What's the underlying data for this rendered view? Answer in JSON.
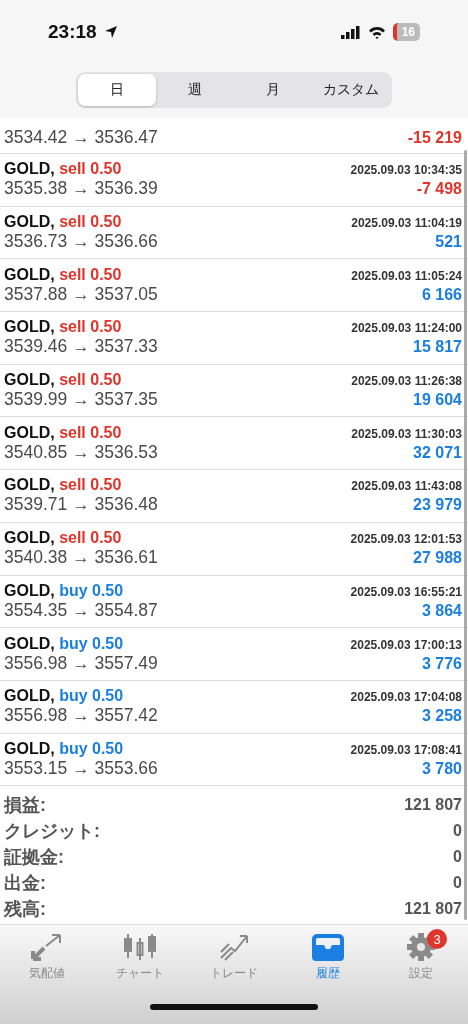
{
  "status_bar": {
    "time": "23:18",
    "battery": "16"
  },
  "period_tabs": [
    {
      "label": "日",
      "selected": true
    },
    {
      "label": "週",
      "selected": false
    },
    {
      "label": "月",
      "selected": false
    },
    {
      "label": "カスタム",
      "selected": false
    }
  ],
  "deals": [
    {
      "prices": "3534.42 → 3536.47",
      "profit": "-15 219",
      "loss": true
    },
    {
      "symbol": "GOLD,",
      "side": "sell 0.50",
      "kind": "sell",
      "time": "2025.09.03 10:34:35",
      "prices": "3535.38 → 3536.39",
      "profit": "-7 498",
      "loss": true
    },
    {
      "symbol": "GOLD,",
      "side": "sell 0.50",
      "kind": "sell",
      "time": "2025.09.03 11:04:19",
      "prices": "3536.73 → 3536.66",
      "profit": "521",
      "loss": false
    },
    {
      "symbol": "GOLD,",
      "side": "sell 0.50",
      "kind": "sell",
      "time": "2025.09.03 11:05:24",
      "prices": "3537.88 → 3537.05",
      "profit": "6 166",
      "loss": false
    },
    {
      "symbol": "GOLD,",
      "side": "sell 0.50",
      "kind": "sell",
      "time": "2025.09.03 11:24:00",
      "prices": "3539.46 → 3537.33",
      "profit": "15 817",
      "loss": false
    },
    {
      "symbol": "GOLD,",
      "side": "sell 0.50",
      "kind": "sell",
      "time": "2025.09.03 11:26:38",
      "prices": "3539.99 → 3537.35",
      "profit": "19 604",
      "loss": false
    },
    {
      "symbol": "GOLD,",
      "side": "sell 0.50",
      "kind": "sell",
      "time": "2025.09.03 11:30:03",
      "prices": "3540.85 → 3536.53",
      "profit": "32 071",
      "loss": false
    },
    {
      "symbol": "GOLD,",
      "side": "sell 0.50",
      "kind": "sell",
      "time": "2025.09.03 11:43:08",
      "prices": "3539.71 → 3536.48",
      "profit": "23 979",
      "loss": false
    },
    {
      "symbol": "GOLD,",
      "side": "sell 0.50",
      "kind": "sell",
      "time": "2025.09.03 12:01:53",
      "prices": "3540.38 → 3536.61",
      "profit": "27 988",
      "loss": false
    },
    {
      "symbol": "GOLD,",
      "side": "buy 0.50",
      "kind": "buy",
      "time": "2025.09.03 16:55:21",
      "prices": "3554.35 → 3554.87",
      "profit": "3 864",
      "loss": false
    },
    {
      "symbol": "GOLD,",
      "side": "buy 0.50",
      "kind": "buy",
      "time": "2025.09.03 17:00:13",
      "prices": "3556.98 → 3557.49",
      "profit": "3 776",
      "loss": false
    },
    {
      "symbol": "GOLD,",
      "side": "buy 0.50",
      "kind": "buy",
      "time": "2025.09.03 17:04:08",
      "prices": "3556.98 → 3557.42",
      "profit": "3 258",
      "loss": false
    },
    {
      "symbol": "GOLD,",
      "side": "buy 0.50",
      "kind": "buy",
      "time": "2025.09.03 17:08:41",
      "prices": "3553.15 → 3553.66",
      "profit": "3 780",
      "loss": false
    }
  ],
  "summary": [
    {
      "label": "損益:",
      "value": "121 807"
    },
    {
      "label": "クレジット:",
      "value": "0"
    },
    {
      "label": "証拠金:",
      "value": "0"
    },
    {
      "label": "出金:",
      "value": "0"
    },
    {
      "label": "残高:",
      "value": "121 807"
    }
  ],
  "tab_bar": [
    {
      "label": "気配値",
      "kind": "quotes",
      "selected": false
    },
    {
      "label": "チャート",
      "kind": "chart",
      "selected": false
    },
    {
      "label": "トレード",
      "kind": "trade",
      "selected": false
    },
    {
      "label": "履歴",
      "kind": "history",
      "selected": true
    },
    {
      "label": "設定",
      "kind": "settings",
      "selected": false,
      "badge": "3"
    }
  ]
}
